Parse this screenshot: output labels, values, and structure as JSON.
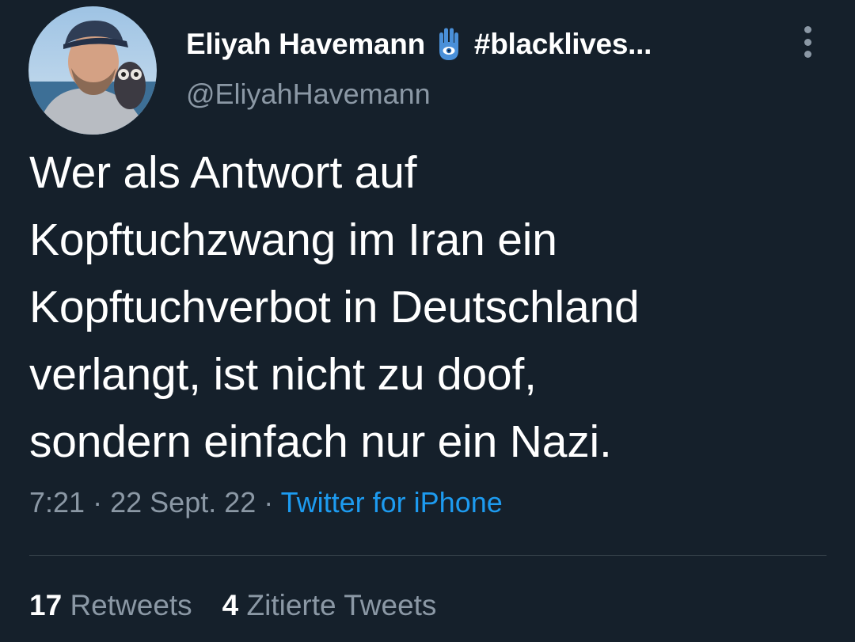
{
  "tweet": {
    "author": {
      "display_name": "Eliyah Havemann",
      "name_suffix": "#blacklives...",
      "handle": "@EliyahHavemann",
      "emoji_icon": "hamsa-icon"
    },
    "text_lines": [
      "Wer als Antwort auf",
      "Kopftuchzwang im Iran ein",
      "Kopftuchverbot in Deutschland",
      "verlangt, ist nicht zu doof,",
      "sondern einfach nur ein Nazi."
    ],
    "meta": {
      "time": "7:21",
      "separator": "·",
      "date": "22 Sept. 22",
      "source": "Twitter for iPhone"
    },
    "stats": [
      {
        "count": "17",
        "label": "Retweets"
      },
      {
        "count": "4",
        "label": "Zitierte Tweets"
      }
    ]
  },
  "colors": {
    "background": "#15202b",
    "primary_text": "#ffffff",
    "secondary_text": "#8b98a5",
    "link": "#1d9bf0",
    "divider": "#38444d",
    "hamsa": "#4a90d9"
  }
}
